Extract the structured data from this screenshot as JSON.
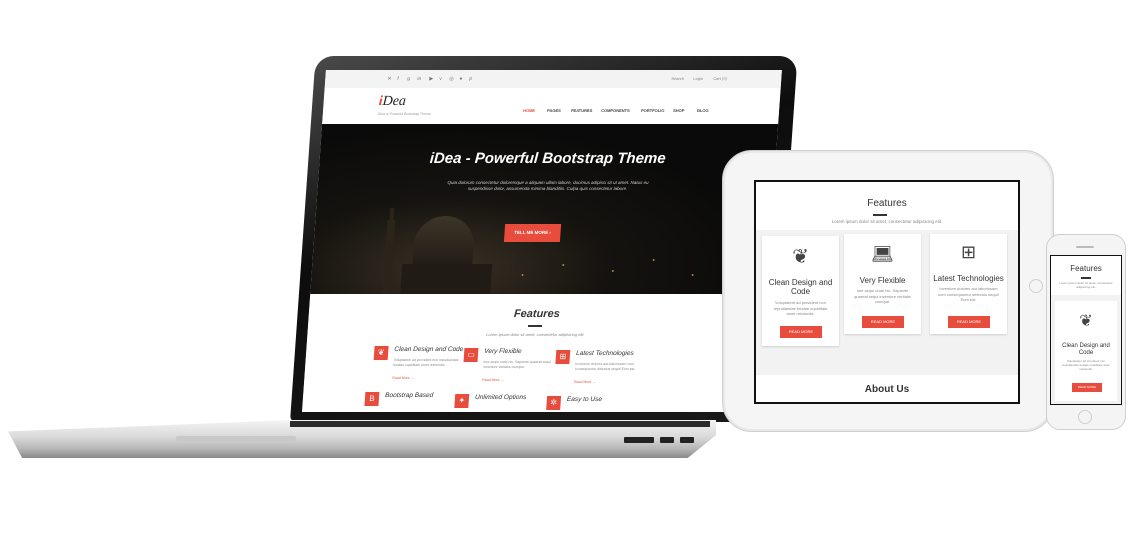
{
  "colors": {
    "accent": "#e74c3c",
    "dark": "#111111",
    "text": "#333333",
    "muted": "#888888"
  },
  "laptop": {
    "topbar": {
      "social_icons": [
        "twitter-icon",
        "facebook-icon",
        "google-plus-icon",
        "linkedin-icon",
        "youtube-icon",
        "vimeo-icon",
        "instagram-icon",
        "flickr-icon",
        "pinterest-icon"
      ],
      "search": "Search",
      "login": "Login",
      "cart": "Cart (0)"
    },
    "logo": {
      "initial": "i",
      "rest": "Dea",
      "tagline": "iDea is Powerful Bootstrap Theme"
    },
    "nav": [
      "HOME",
      "PAGES",
      "FEATURES",
      "COMPONENTS",
      "PORTFOLIO",
      "SHOP",
      "BLOG"
    ],
    "hero": {
      "title": "iDea - Powerful Bootstrap Theme",
      "text": "Quia dolorum consectetur doloremque a aliquam ullam labore, ducimus adipisci sit ut amet. Natus eu suspendisse dolor, assumenda minima blanditiis. Culpa quis consectetur labore.",
      "button": "TELL ME MORE"
    },
    "features": {
      "title": "Features",
      "subtitle": "Lorem ipsum dolor sit amet, consectetur adipisicing elit.",
      "items": [
        {
          "heading": "Clean Design and Code",
          "text": "Voluptatem ad provident non repudiandae beatae cupiditate amet reiciendis.",
          "more": "Read More"
        },
        {
          "heading": "Very Flexible",
          "text": "Iure sequi unde hic. Sapiente quaerat sequi inventore veritatis cumque.",
          "more": "Read More"
        },
        {
          "heading": "Latest Technologies",
          "text": "Inventore dolores aut laboriosam cum consequuntur delectus sequi! Eum est.",
          "more": "Read More"
        },
        {
          "heading": "Bootstrap Based"
        },
        {
          "heading": "Unlimited Options"
        },
        {
          "heading": "Easy to Use"
        }
      ]
    }
  },
  "tablet": {
    "features_title": "Features",
    "subtitle": "Lorem ipsum dolor sit amet, consectetur adipisicing elit.",
    "cards": [
      {
        "icon": "leaf-icon",
        "heading": "Clean Design and Code",
        "text": "Voluptatem ad provident non repudiandae beatae cupiditate amet reiciendis.",
        "button": "READ MORE"
      },
      {
        "icon": "laptop-icon",
        "heading": "Very Flexible",
        "text": "Iure sequi unde hic. Sapiente quaerat sequi inventore veritatis cumque.",
        "button": "READ MORE"
      },
      {
        "icon": "sitemap-icon",
        "heading": "Latest Technologies",
        "text": "Inventore dolores aut laboriosam cum consequuntur delectus sequi! Eum est.",
        "button": "READ MORE"
      }
    ],
    "about_title": "About Us"
  },
  "phone": {
    "features_title": "Features",
    "subtitle": "Lorem ipsum dolor sit amet, consectetur adipisicing elit.",
    "card": {
      "icon": "leaf-icon",
      "heading": "Clean Design and Code",
      "text": "Voluptatem ad provident non repudiandae beatae cupiditate amet reiciendis.",
      "button": "READ MORE"
    }
  }
}
